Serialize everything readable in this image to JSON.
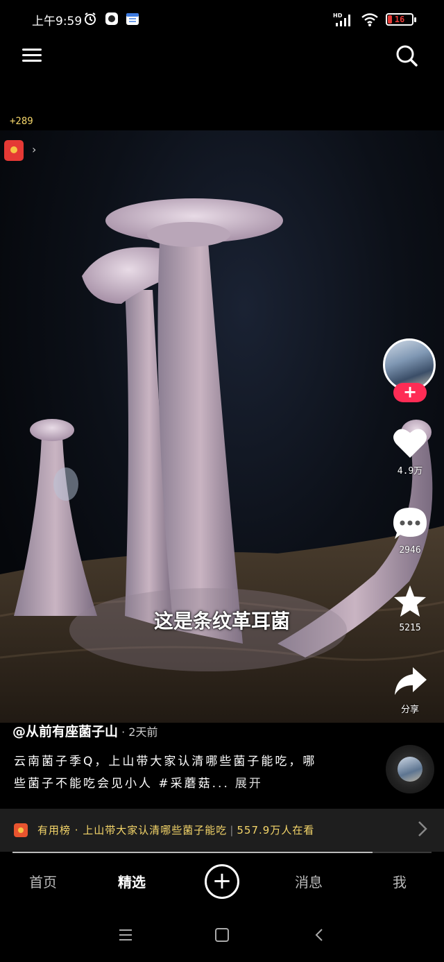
{
  "status_bar": {
    "time": "上午9:59",
    "network": "HD",
    "battery": "16",
    "battery_level": 0.16
  },
  "top_nav": {
    "menu_icon": "hamburger-menu-icon",
    "search_icon": "search-icon"
  },
  "coins": "+289",
  "video": {
    "caption": "这是条纹革耳菌",
    "redpacket_icon": "red-envelope-icon"
  },
  "rail": {
    "follow_label": "+",
    "likes": "4.9万",
    "comments": "2946",
    "favorites": "5215",
    "share": "分享"
  },
  "post": {
    "author": "@从前有座菌子山",
    "time": " · 2天前",
    "description": "云南菌子季Q，上山带大家认清哪些菌子能吃，哪些菌子不能吃会见小人 #采蘑菇...",
    "expand": "展开"
  },
  "live_banner": {
    "text": "有用榜 · 上山带大家认清哪些菌子能吃",
    "viewers": "557.9万人在看",
    "progress": 0.86
  },
  "bottom_nav": {
    "home": "首页",
    "featured": "精选",
    "add": "+",
    "messages": "消息",
    "me": "我"
  },
  "colors": {
    "accent": "#fe2c55",
    "banner_text": "#f5d66a",
    "battery_low": "#e53935"
  }
}
